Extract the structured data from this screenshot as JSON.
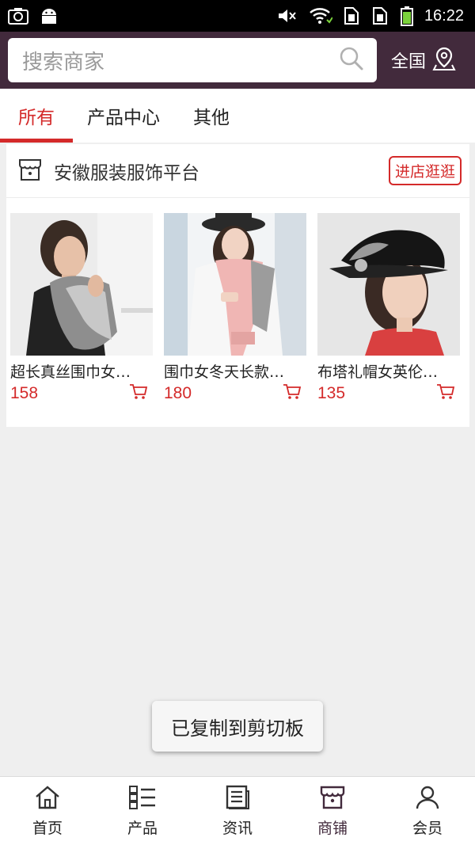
{
  "status_bar": {
    "time": "16:22",
    "icons": [
      "camera-icon",
      "android-icon",
      "mute-icon",
      "wifi-icon",
      "sim1-icon",
      "sim2-icon",
      "battery-icon"
    ]
  },
  "search": {
    "placeholder": "搜索商家",
    "icon": "search-icon"
  },
  "region": {
    "label": "全国",
    "icon": "location-pin-icon"
  },
  "tabs": [
    {
      "label": "所有",
      "active": true
    },
    {
      "label": "产品中心",
      "active": false
    },
    {
      "label": "其他",
      "active": false
    }
  ],
  "store": {
    "name": "安徽服装服饰平台",
    "icon": "shop-icon",
    "visit_label": "进店逛逛"
  },
  "products": [
    {
      "title": "超长真丝围巾女…",
      "price": "158"
    },
    {
      "title": "围巾女冬天长款…",
      "price": "180"
    },
    {
      "title": "布塔礼帽女英伦…",
      "price": "135"
    }
  ],
  "toast": "已复制到剪切板",
  "bottom_nav": [
    {
      "label": "首页",
      "icon": "home-icon",
      "active": false
    },
    {
      "label": "产品",
      "icon": "list-icon",
      "active": false
    },
    {
      "label": "资讯",
      "icon": "news-icon",
      "active": false
    },
    {
      "label": "商铺",
      "icon": "shop-icon",
      "active": true
    },
    {
      "label": "会员",
      "icon": "user-icon",
      "active": false
    }
  ],
  "colors": {
    "header_bg": "#422a3c",
    "accent_red": "#d42a2a",
    "page_bg": "#efefef"
  }
}
